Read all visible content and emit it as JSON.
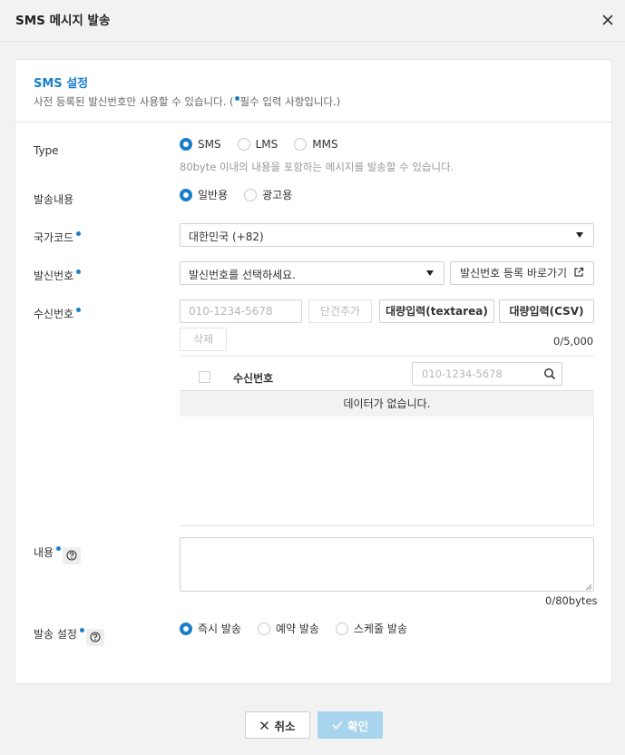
{
  "dialog": {
    "title": "SMS 메시지 발송",
    "close_icon": "close-icon"
  },
  "card": {
    "title": "SMS 설정",
    "subtitle_before": "사전 등록된 발신번호만 사용할 수 있습니다. (",
    "subtitle_after": "필수 입력 사항입니다.)"
  },
  "type": {
    "label": "Type",
    "options": [
      {
        "label": "SMS",
        "selected": true
      },
      {
        "label": "LMS",
        "selected": false
      },
      {
        "label": "MMS",
        "selected": false
      }
    ],
    "hint": "80byte 이내의 내용을 포함하는 메시지를 발송할 수 있습니다."
  },
  "send_content": {
    "label": "발송내용",
    "options": [
      {
        "label": "일반용",
        "selected": true
      },
      {
        "label": "광고용",
        "selected": false
      }
    ]
  },
  "country_code": {
    "label": "국가코드",
    "selected": "대한민국 (+82)"
  },
  "sender": {
    "label": "발신번호",
    "placeholder": "발신번호를 선택하세요.",
    "register_button": "발신번호 등록 바로가기"
  },
  "recipient": {
    "label": "수신번호",
    "input_placeholder": "010-1234-5678",
    "add_button": "단건추가",
    "bulk_textarea_button": "대량입력(textarea)",
    "bulk_csv_button": "대량입력(CSV)",
    "delete_button": "삭제",
    "count": "0/5,000",
    "table": {
      "column": "수신번호",
      "search_placeholder": "010-1234-5678",
      "empty_message": "데이터가 없습니다."
    }
  },
  "content": {
    "label": "내용",
    "value": "",
    "count": "0/80bytes"
  },
  "send_setting": {
    "label": "발송 설정",
    "options": [
      {
        "label": "즉시 발송",
        "selected": true
      },
      {
        "label": "예약 발송",
        "selected": false
      },
      {
        "label": "스케줄 발송",
        "selected": false
      }
    ]
  },
  "footer": {
    "cancel": "취소",
    "confirm": "확인"
  },
  "colors": {
    "accent": "#1a7ec9",
    "confirm_disabled": "#a8d4ee"
  }
}
